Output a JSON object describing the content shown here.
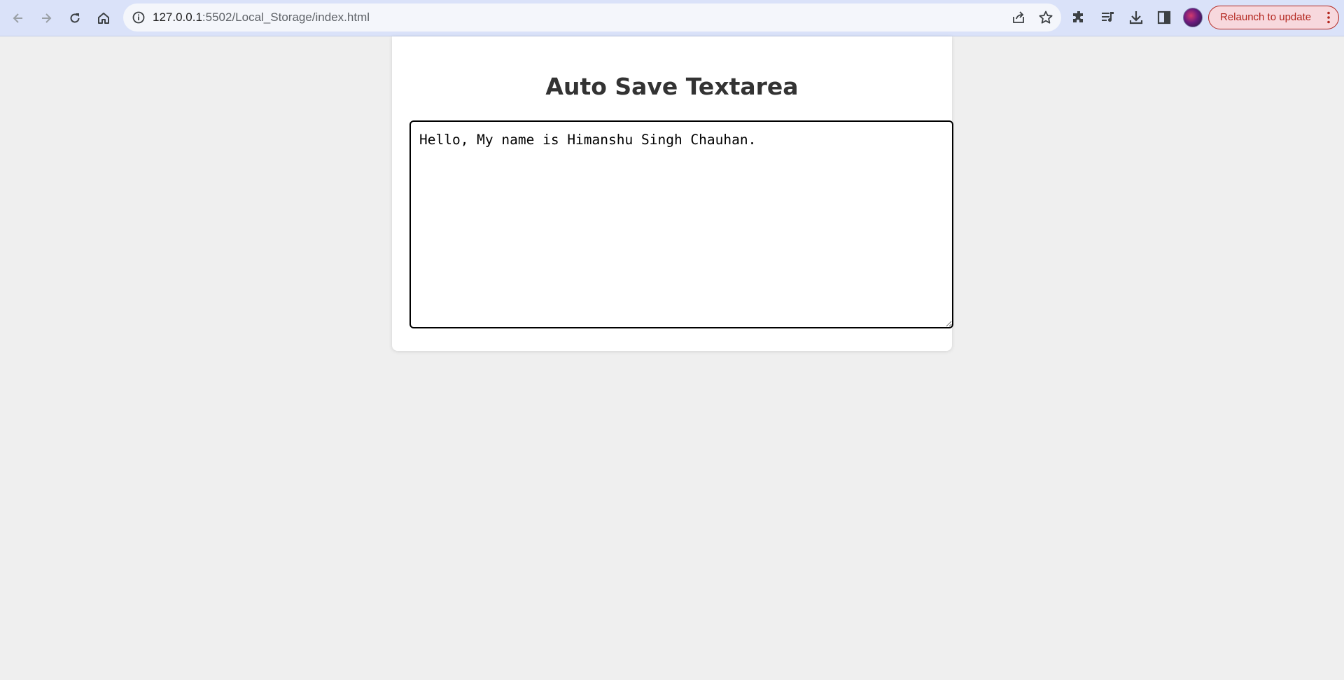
{
  "browser": {
    "url_host": "127.0.0.1",
    "url_rest": ":5502/Local_Storage/index.html",
    "relaunch_label": "Relaunch to update",
    "icons": [
      "back-icon",
      "forward-icon",
      "reload-icon",
      "home-icon",
      "site-info-icon",
      "share-icon",
      "bookmark-star-icon",
      "extensions-icon",
      "media-control-icon",
      "downloads-icon",
      "side-panel-icon",
      "profile-avatar",
      "more-menu-icon"
    ],
    "colors": {
      "toolbar": "#dae2f9",
      "omnibox": "#f4f6fb",
      "relaunch": "#b3261e"
    }
  },
  "page": {
    "title": "Auto Save Textarea",
    "textarea_value": "Hello, My name is Himanshu Singh Chauhan."
  }
}
